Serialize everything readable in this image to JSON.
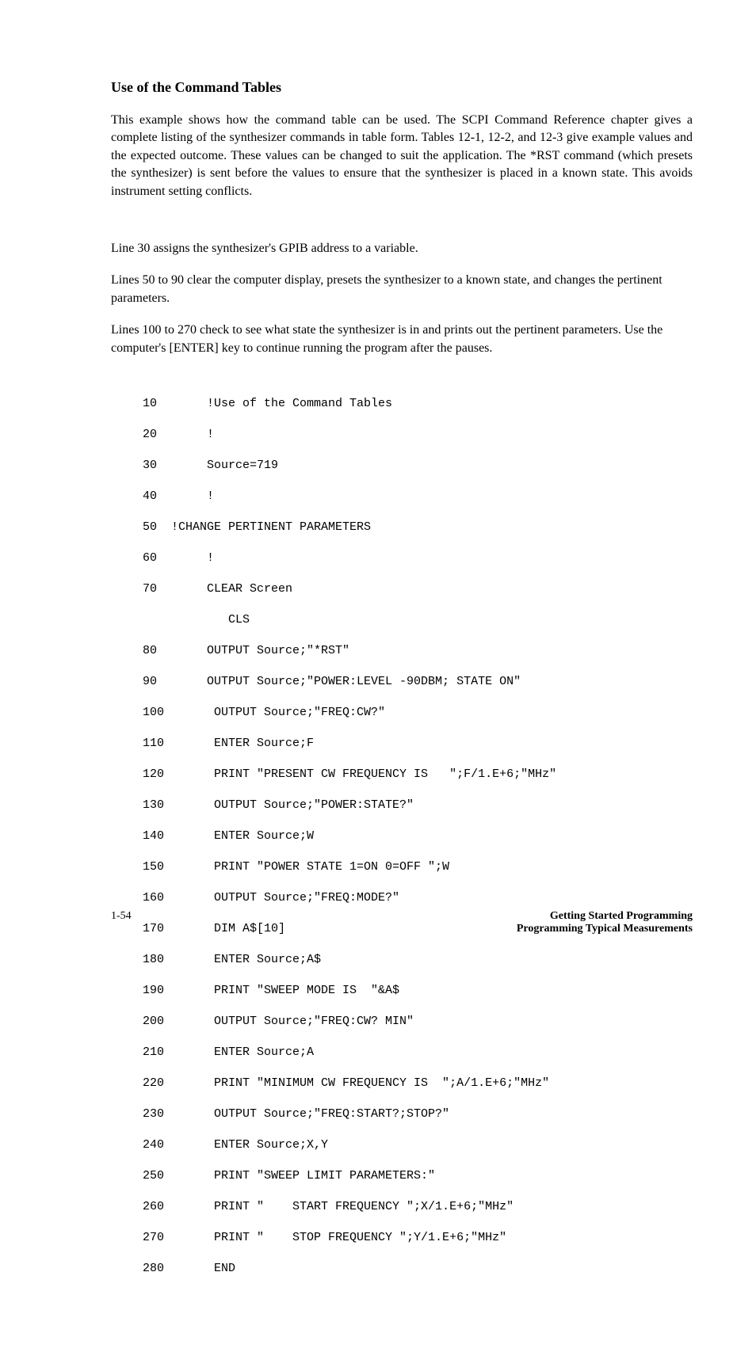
{
  "header": {
    "title": "Programming Typical Measurements",
    "subtitle": "Use of the Command Tables"
  },
  "intro": {
    "p1": "This example shows how the command table can be used. The SCPI Command Reference chapter gives a complete listing of the synthesizer commands in table form. Tables 12-1, 12-2, and 12-3 give example values and the expected outcome. These values can be changed to suit the application. The *RST command (which presets the synthesizer) is sent before the values to ensure that the synthesizer is placed in a known state. This avoids instrument setting conflicts."
  },
  "notes": {
    "p1": "Line 30 assigns the synthesizer's GPIB address to a variable.",
    "p2": "Lines 50 to 90 clear the computer display, presets the synthesizer to a known state, and changes the pertinent parameters.",
    "p3": "Lines 100 to 270 check to see what state the synthesizer is in and prints out the pertinent parameters. Use the computer's [ENTER] key to continue running the program after the pauses."
  },
  "code": {
    "l10": "10       !Use of the Command Tables",
    "l20": "20       !",
    "l30": "30       Source=719",
    "l40": "40       !",
    "l50": "50  !CHANGE PERTINENT PARAMETERS",
    "l60": "60       !",
    "l70": "70       CLEAR Screen",
    "l75": "            CLS",
    "l80": "80       OUTPUT Source;\"*RST\"",
    "l90": "90       OUTPUT Source;\"POWER:LEVEL -90DBM; STATE ON\"",
    "l100": "100       OUTPUT Source;\"FREQ:CW?\"",
    "l110": "110       ENTER Source;F",
    "l120": "120       PRINT \"PRESENT CW FREQUENCY IS   \";F/1.E+6;\"MHz\"",
    "l130": "130       OUTPUT Source;\"POWER:STATE?\"",
    "l140": "140       ENTER Source;W",
    "l150": "150       PRINT \"POWER STATE 1=ON 0=OFF \";W",
    "l160": "160       OUTPUT Source;\"FREQ:MODE?\"",
    "l170": "170       DIM A$[10]",
    "l180": "180       ENTER Source;A$",
    "l190": "190       PRINT \"SWEEP MODE IS  \"&A$",
    "l200": "200       OUTPUT Source;\"FREQ:CW? MIN\"",
    "l210": "210       ENTER Source;A",
    "l220": "220       PRINT \"MINIMUM CW FREQUENCY IS  \";A/1.E+6;\"MHz\"",
    "l230": "230       OUTPUT Source;\"FREQ:START?;STOP?\"",
    "l240": "240       ENTER Source;X,Y",
    "l250": "250       PRINT \"SWEEP LIMIT PARAMETERS:\"",
    "l260": "260       PRINT \"    START FREQUENCY \";X/1.E+6;\"MHz\"",
    "l270": "270       PRINT \"    STOP FREQUENCY \";Y/1.E+6;\"MHz\"",
    "l280": "280       END"
  },
  "footer": {
    "page": "1-54",
    "chapter_line1": "Getting Started Programming",
    "chapter_line2": "Programming Typical Measurements"
  }
}
